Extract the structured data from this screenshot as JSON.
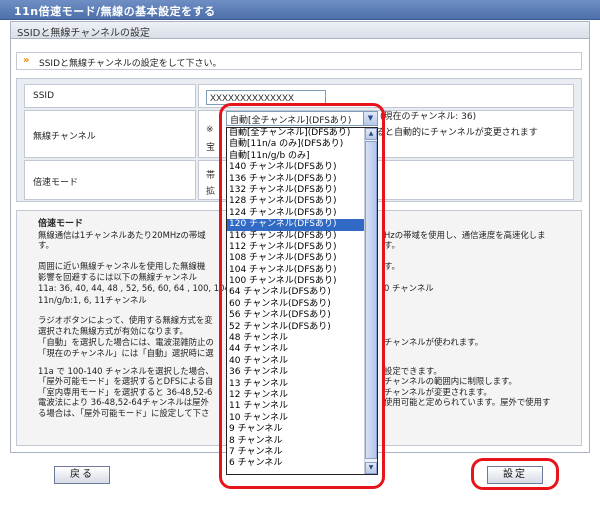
{
  "page": {
    "title": "11n倍速モード/無線の基本設定をする",
    "section_header": "SSIDと無線チャンネルの設定",
    "instruction": "SSIDと無線チャンネルの設定をして下さい。"
  },
  "form": {
    "ssid_label": "SSID",
    "ssid_value": "XXXXXXXXXXXXXX",
    "channel_label": "無線チャンネル",
    "channel_selected": "自動[全チャンネル](DFSあり)",
    "current_channel_note": "(現在のチャンネル: 36)",
    "channel_auto_note": "ると自動的にチャンネルが変更されます",
    "mark_note": "※",
    "partial_button_text": "宝",
    "fast_mode_label": "倍速モード",
    "fast_mode_partial_1": "帯",
    "fast_mode_partial_2": "拡"
  },
  "dropdown": {
    "options": [
      "自動[全チャンネル](DFSあり)",
      "自動[11n/a のみ](DFSあり)",
      "自動[11n/g/b のみ]",
      "140 チャンネル(DFSあり)",
      "136 チャンネル(DFSあり)",
      "132 チャンネル(DFSあり)",
      "128 チャンネル(DFSあり)",
      "124 チャンネル(DFSあり)",
      "120 チャンネル(DFSあり)",
      "116 チャンネル(DFSあり)",
      "112 チャンネル(DFSあり)",
      "108 チャンネル(DFSあり)",
      "104 チャンネル(DFSあり)",
      "100 チャンネル(DFSあり)",
      "64 チャンネル(DFSあり)",
      "60 チャンネル(DFSあり)",
      "56 チャンネル(DFSあり)",
      "52 チャンネル(DFSあり)",
      "48 チャンネル",
      "44 チャンネル",
      "40 チャンネル",
      "36 チャンネル",
      "13 チャンネル",
      "12 チャンネル",
      "11 チャンネル",
      "10 チャンネル",
      "9 チャンネル",
      "8 チャンネル",
      "7 チャンネル",
      "6 チャンネル"
    ],
    "highlighted_option": "120 チャンネル(DFSあり)"
  },
  "help": {
    "title": "倍速モード",
    "lines": [
      "無線通信は1チャンネルあたり20MHzの帯域",
      "す。",
      "周囲に近い無線チャンネルを使用した無線機",
      "影響を回避するには以下の無線チャンネル",
      "11a: 36, 40, 44, 48 , 52, 56, 60, 64 , 100, 104,",
      "11n/g/b:1, 6, 11チャンネル",
      "ラジオボタンによって、使用する無線方式を変",
      "選択された無線方式が有効になります。",
      "「自動」を選択した場合には、電波混雑防止の",
      "「現在のチャンネル」には「自動」選択時に選",
      "11a で 100-140 チャンネルを選択した場合、",
      "「屋外可能モード」を選択するとDFSによる自",
      "「室内専用モード」を選択すると 36-48,52-6",
      "電波法により 36-48,52-64チャンネルは屋外",
      "る場合は、「屋外可能モード」に設定して下さ"
    ],
    "right_lines": [
      "Hzの帯域を使用し、通信速度を高速化しま",
      "す。",
      "0 チャンネル",
      "チャンネルが使われます。",
      "設定できます。",
      "チャンネルの範囲内に制限します。",
      "チャンネルが変更されます。",
      "使用可能と定められています。屋外で使用す"
    ]
  },
  "buttons": {
    "back": "戻る",
    "set": "設定"
  }
}
